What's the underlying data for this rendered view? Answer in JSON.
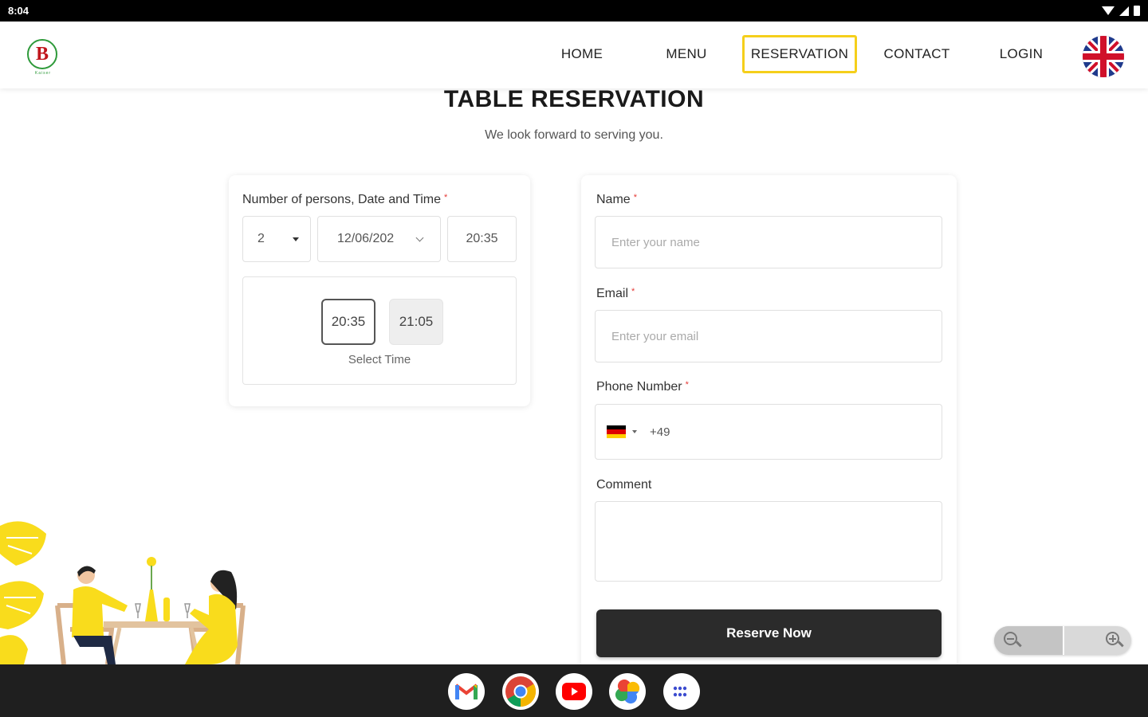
{
  "status_bar": {
    "time": "8:04"
  },
  "nav": {
    "items": [
      {
        "label": "HOME"
      },
      {
        "label": "MENU"
      },
      {
        "label": "RESERVATION"
      },
      {
        "label": "CONTACT"
      },
      {
        "label": "LOGIN"
      }
    ],
    "active": "RESERVATION"
  },
  "logo": {
    "letter": "B",
    "tagline": "Kaiser"
  },
  "page": {
    "title": "TABLE RESERVATION",
    "subtitle": "We look forward to serving you."
  },
  "booking": {
    "label": "Number of persons, Date and Time",
    "required_mark": "*",
    "persons": "2",
    "date": "12/06/202",
    "time": "20:35",
    "slots": [
      "20:35",
      "21:05"
    ],
    "selected_slot": "20:35",
    "select_time_label": "Select Time"
  },
  "form": {
    "name_label": "Name",
    "name_placeholder": "Enter your name",
    "email_label": "Email",
    "email_placeholder": "Enter your email",
    "phone_label": "Phone Number",
    "phone_code": "+49",
    "comment_label": "Comment",
    "required_mark": "*",
    "submit_label": "Reserve Now"
  },
  "colors": {
    "accent": "#f5cf1b",
    "button": "#2b2b2b",
    "required": "#e53935",
    "illustration_yellow": "#f9dc1c"
  },
  "taskbar": {
    "apps": [
      "gmail-icon",
      "chrome-icon",
      "youtube-icon",
      "photos-icon",
      "app-launcher-icon"
    ]
  }
}
